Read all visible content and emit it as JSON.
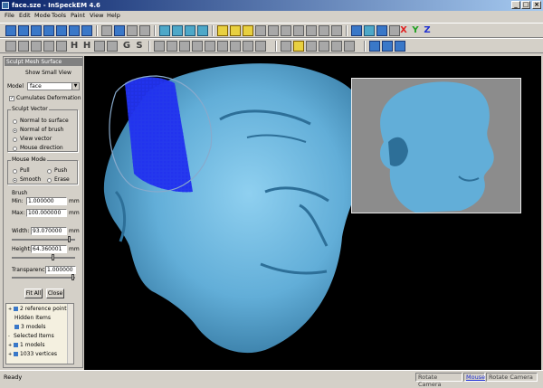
{
  "window": {
    "title": "face.sze - InSpeckEM 4.6"
  },
  "menu": [
    "File",
    "Edit",
    "Mode",
    "Tools",
    "Paint",
    "View",
    "Help"
  ],
  "toolbar": {
    "axes": [
      "X",
      "Y",
      "Z"
    ],
    "h_labels": [
      "H",
      "H"
    ],
    "g_labels": [
      "G",
      "S"
    ]
  },
  "panel": {
    "title": "Sculpt Mesh Surface",
    "show_small_view": "Show Small View",
    "model_label": "Model",
    "model_value": "face",
    "cumulates_label": "Cumulates Deformation",
    "cumulates_checked": true,
    "sculpt_vector": {
      "legend": "Sculpt Vector",
      "options": [
        "Normal to surface",
        "Normal of brush",
        "View vector",
        "Mouse direction"
      ],
      "selected": "Normal of brush"
    },
    "mouse_mode": {
      "legend": "Mouse Mode",
      "options": [
        "Pull",
        "Push",
        "Smooth",
        "Erase"
      ],
      "selected": "Smooth"
    },
    "brush": {
      "legend": "Brush",
      "min_label": "Min:",
      "min_value": "1.000000",
      "min_unit": "mm",
      "max_label": "Max:",
      "max_value": "100.000000",
      "max_unit": "mm",
      "width_label": "Width:",
      "width_value": "93.070000",
      "width_unit": "mm",
      "height_label": "Height:",
      "height_value": "64.360001",
      "height_unit": "mm",
      "transparency_label": "Transparency:",
      "transparency_value": "1.000000"
    },
    "buttons": {
      "fit_all": "Fit All",
      "close": "Close"
    },
    "tree": [
      "2 reference points",
      "Hidden Items",
      "3 models",
      "Selected Items",
      "1 models",
      "1033 vertices"
    ]
  },
  "status": {
    "ready": "Ready",
    "panels": [
      "Rotate Camera",
      "Mouse",
      "Rotate Camera"
    ],
    "highlight": "Mouse"
  },
  "colors": {
    "face": "#62aed8",
    "face_shadow": "#2d6f98",
    "brush_points": "#2233ee",
    "title_gradient_start": "#0a246a",
    "axis_x": "#e02020",
    "axis_y": "#20a020",
    "axis_z": "#2030d0"
  }
}
